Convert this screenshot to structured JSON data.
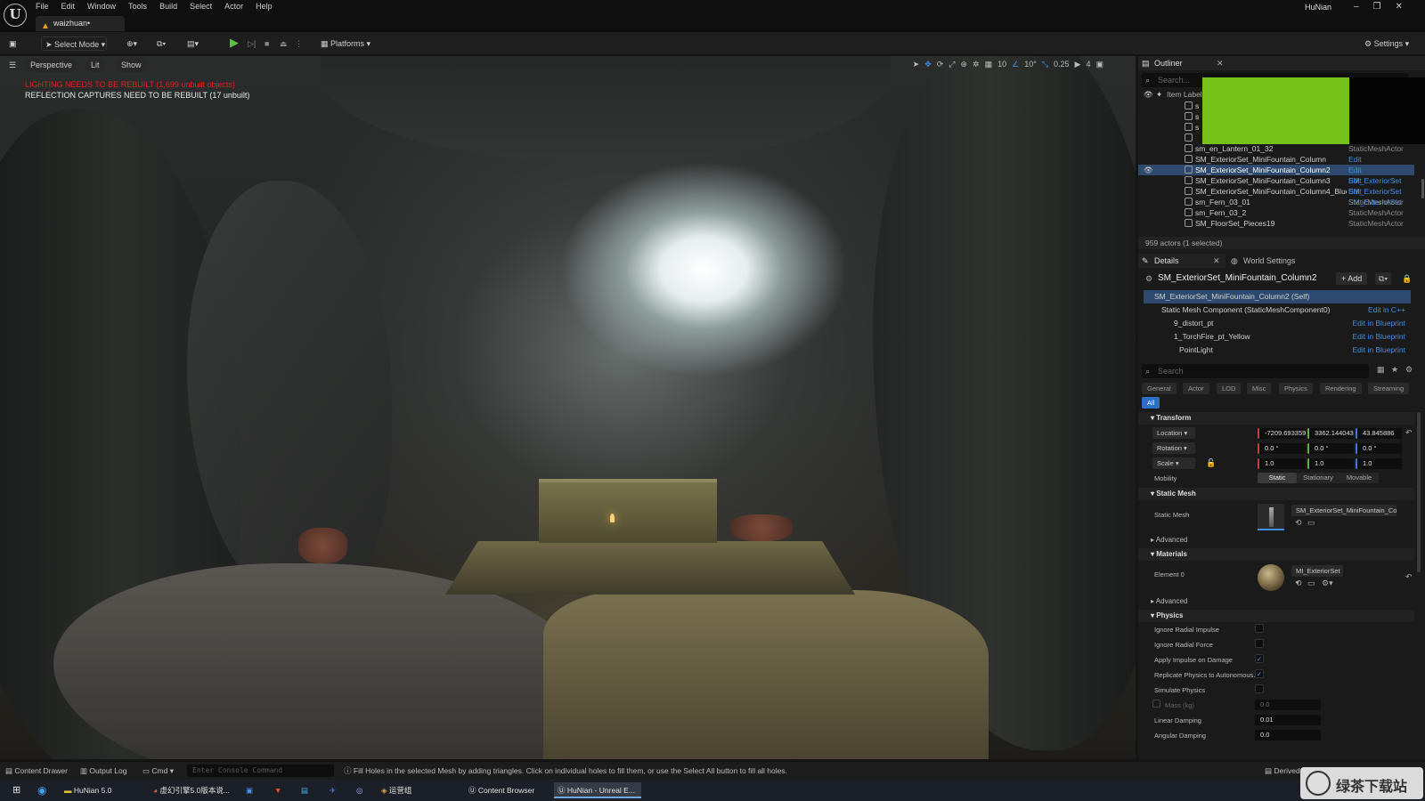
{
  "app": {
    "level_tab": "waizhuan•",
    "project_name": "HuNian"
  },
  "menu": [
    "File",
    "Edit",
    "Window",
    "Tools",
    "Build",
    "Select",
    "Actor",
    "Help"
  ],
  "window_controls": [
    "–",
    "❐",
    "✕"
  ],
  "toolbar": {
    "select_mode": "Select Mode",
    "platforms": "Platforms",
    "settings": "Settings"
  },
  "viewport": {
    "perspective": "Perspective",
    "lit": "Lit",
    "show": "Show",
    "warning_lighting": "LIGHTING NEEDS TO BE REBUILT (1,699 unbuilt objects)",
    "warning_reflection": "REFLECTION CAPTURES NEED TO BE REBUILT (17 unbuilt)",
    "grid_snap": "10",
    "rotation_snap": "10°",
    "scale_snap": "0.25",
    "camera_speed": "4"
  },
  "outliner": {
    "title": "Outliner",
    "search_placeholder": "Search...",
    "column_label": "Item Label",
    "rows": [
      {
        "name": "sm_en_Lantern_01_32",
        "type": "StaticMeshActor",
        "link": false,
        "selected": false
      },
      {
        "name": "SM_ExteriorSet_MiniFountain_Column",
        "type": "Edit SM_ExteriorSet",
        "link": true,
        "selected": false
      },
      {
        "name": "SM_ExteriorSet_MiniFountain_Column2",
        "type": "Edit SM_ExteriorSet",
        "link": true,
        "selected": true
      },
      {
        "name": "SM_ExteriorSet_MiniFountain_Column3",
        "type": "Edit SM_ExteriorSet",
        "link": true,
        "selected": false
      },
      {
        "name": "SM_ExteriorSet_MiniFountain_Column4_Blue",
        "type": "Edit SM_ExteriorSet",
        "link": true,
        "selected": false
      },
      {
        "name": "sm_Fern_03_01",
        "type": "StaticMeshActor",
        "link": false,
        "selected": false
      },
      {
        "name": "sm_Fern_03_2",
        "type": "StaticMeshActor",
        "link": false,
        "selected": false
      },
      {
        "name": "SM_FloorSet_Pieces19",
        "type": "StaticMeshActor",
        "link": false,
        "selected": false
      }
    ],
    "status": "959 actors (1 selected)"
  },
  "details": {
    "tab": "Details",
    "world_settings_tab": "World Settings",
    "actor_name": "SM_ExteriorSet_MiniFountain_Column2",
    "add_button": "+ Add",
    "components": [
      {
        "label": "SM_ExteriorSet_MiniFountain_Column2 (Self)",
        "link": ""
      },
      {
        "label": "Static Mesh Component (StaticMeshComponent0)",
        "link": "Edit in C++"
      },
      {
        "label": "9_distort_pt",
        "link": "Edit in Blueprint"
      },
      {
        "label": "1_TorchFire_pt_Yellow",
        "link": "Edit in Blueprint"
      },
      {
        "label": "PointLight",
        "link": "Edit in Blueprint"
      }
    ],
    "search_placeholder": "Search",
    "categories": [
      "General",
      "Actor",
      "LOD",
      "Misc",
      "Physics",
      "Rendering",
      "Streaming"
    ],
    "all_tab": "All",
    "transform": {
      "title": "Transform",
      "location_label": "Location",
      "location": [
        "-7209.693359",
        "3362.144043",
        "43.845886"
      ],
      "rotation_label": "Rotation",
      "rotation": [
        "0.0 °",
        "0.0 °",
        "0.0 °"
      ],
      "scale_label": "Scale",
      "scale": [
        "1.0",
        "1.0",
        "1.0"
      ],
      "mobility_label": "Mobility",
      "mobility": [
        "Static",
        "Stationary",
        "Movable"
      ]
    },
    "static_mesh": {
      "title": "Static Mesh",
      "label": "Static Mesh",
      "value": "SM_ExteriorSet_MiniFountain_Col",
      "advanced": "Advanced"
    },
    "materials": {
      "title": "Materials",
      "element_label": "Element 0",
      "value": "MI_ExteriorSet",
      "advanced": "Advanced"
    },
    "physics": {
      "title": "Physics",
      "rows": [
        {
          "label": "Ignore Radial Impulse",
          "checked": false
        },
        {
          "label": "Ignore Radial Force",
          "checked": false
        },
        {
          "label": "Apply Impulse on Damage",
          "checked": true
        },
        {
          "label": "Replicate Physics to Autonomous...",
          "checked": true
        },
        {
          "label": "Simulate Physics",
          "checked": false
        }
      ],
      "mass_label": "Mass (kg)",
      "mass_value": "0.0",
      "linear_damping_label": "Linear Damping",
      "linear_damping": "0.01",
      "angular_damping_label": "Angular Damping",
      "angular_damping": "0.0"
    }
  },
  "statusbar": {
    "content_drawer": "Content Drawer",
    "output_log": "Output Log",
    "cmd": "Cmd",
    "console_placeholder": "Enter Console Command",
    "hint": "Fill Holes in the selected Mesh by adding triangles. Click on individual holes to fill them, or use the Select All button to fill all holes.",
    "derived": "Derived"
  },
  "taskbar": [
    {
      "label": "HuNian 5.0"
    },
    {
      "label": "虚幻引擎5.0版本说..."
    },
    {
      "label": "运营组"
    },
    {
      "label": "Content Browser"
    },
    {
      "label": "HuNian - Unreal E..."
    }
  ],
  "watermark_text": "绿茶下载站"
}
